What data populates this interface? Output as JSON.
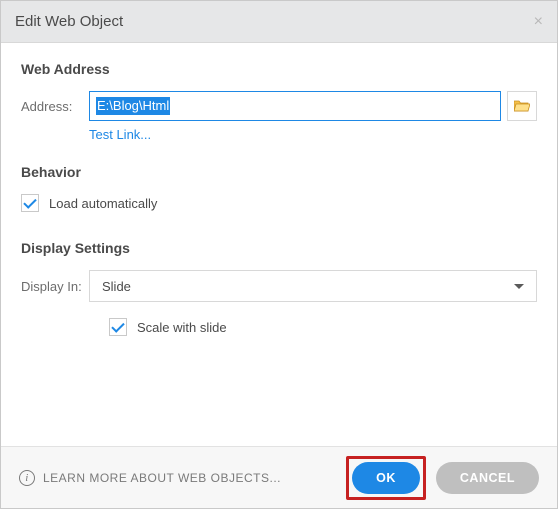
{
  "dialog": {
    "title": "Edit Web Object"
  },
  "webAddress": {
    "heading": "Web Address",
    "addressLabel": "Address:",
    "addressValue": "E:\\Blog\\Html",
    "testLink": "Test Link..."
  },
  "behavior": {
    "heading": "Behavior",
    "loadAuto": "Load automatically"
  },
  "display": {
    "heading": "Display Settings",
    "displayInLabel": "Display In:",
    "displayInValue": "Slide",
    "scaleWithSlide": "Scale with slide"
  },
  "footer": {
    "learnMore": "LEARN MORE ABOUT WEB OBJECTS...",
    "ok": "OK",
    "cancel": "CANCEL"
  }
}
